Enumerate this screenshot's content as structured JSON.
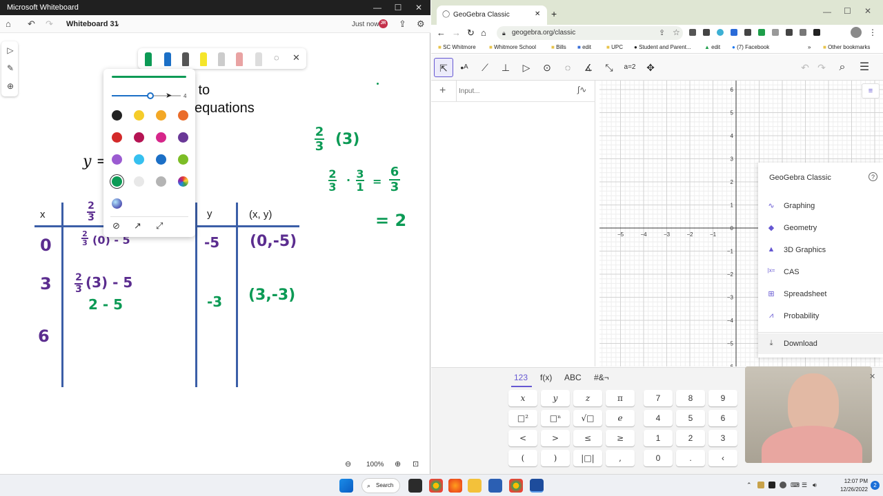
{
  "whiteboard": {
    "window_title": "Microsoft Whiteboard",
    "board_name": "Whiteboard 31",
    "saved_status": "Just now",
    "user_initials": "JR",
    "pen_size_value": "4",
    "zoom": "100%",
    "board_text": {
      "heading_line1": "bra to",
      "heading_line2": "equations",
      "equation_partial": "y =",
      "col_x": "x",
      "col_y": "y",
      "col_xy": "(x, y)",
      "fraction_num": "2",
      "fraction_den": "3",
      "rows": [
        {
          "x": "0",
          "expr1": "(0) - 5",
          "expr_num": "2",
          "expr_den": "3",
          "y": "-5",
          "pair": "(0,-5)"
        },
        {
          "x": "3",
          "expr1": "(3) - 5",
          "expr_num": "2",
          "expr_den": "3",
          "expr2": "2 - 5",
          "y": "-3",
          "pair": "(3,-3)"
        },
        {
          "x": "6"
        }
      ],
      "side_work": {
        "line1_frac_num": "2",
        "line1_frac_den": "3",
        "line1_rest": "(3)",
        "line2_a_num": "2",
        "line2_a_den": "3",
        "line2_dot": "·",
        "line2_b_num": "3",
        "line2_b_den": "1",
        "line2_eq": "=",
        "line2_c_num": "6",
        "line2_c_den": "3",
        "line3": "= 2"
      }
    },
    "colors": {
      "ink_green": "#0c9a55",
      "ink_purple": "#5b2d8f",
      "table_blue": "#3b5ea7"
    },
    "swatches": [
      "#222222",
      "#f5cc2a",
      "#f3a826",
      "#ea6c2a",
      "#d32a2a",
      "#b51453",
      "#d6268a",
      "#6a3897",
      "#9b5bd1",
      "#36c0ef",
      "#1b6fc6",
      "#7cbd26",
      "#0c9a55",
      "#e8e8e8",
      "#b4b4b4",
      "rainbow",
      "galaxy"
    ]
  },
  "browser": {
    "tab_title": "GeoGebra Classic",
    "url": "geogebra.org/classic",
    "bookmarks": [
      "SC Whitmore",
      "Whitmore School",
      "Bills",
      "edit",
      "UPC",
      "Student and Parent...",
      "edit",
      "(7) Facebook",
      "Other bookmarks"
    ],
    "more_bookmarks": "»"
  },
  "geogebra": {
    "input_placeholder": "Input...",
    "axis_y_ticks": [
      "6",
      "5",
      "4",
      "3",
      "2",
      "1",
      "0",
      "−1",
      "−2",
      "−3",
      "−4",
      "−5",
      "−6"
    ],
    "axis_x_ticks": [
      "−5",
      "−4",
      "−3",
      "−2",
      "−1"
    ],
    "menu_title": "GeoGebra Classic",
    "menu_items": [
      "Graphing",
      "Geometry",
      "3D Graphics",
      "CAS",
      "Spreadsheet",
      "Probability",
      "Download"
    ],
    "menu_icons": [
      "graph-icon",
      "geometry-icon",
      "3d-icon",
      "cas-icon",
      "spreadsheet-icon",
      "probability-icon",
      "download-icon"
    ],
    "keyboard_tabs": [
      "123",
      "f(x)",
      "ABC",
      "#&¬"
    ],
    "keys_left": [
      [
        "x",
        "y",
        "z",
        "π"
      ],
      [
        "□²",
        "□ⁿ",
        "√□",
        "e"
      ],
      [
        "<",
        ">",
        "≤",
        "≥"
      ],
      [
        "(",
        ")",
        "|□|",
        ","
      ]
    ],
    "keys_num": [
      [
        "7",
        "8",
        "9"
      ],
      [
        "4",
        "5",
        "6"
      ],
      [
        "1",
        "2",
        "3"
      ],
      [
        "0",
        ".",
        "‹"
      ]
    ]
  },
  "taskbar": {
    "search_label": "Search",
    "time": "12:07 PM",
    "date": "12/26/2022",
    "notification_count": "2"
  }
}
